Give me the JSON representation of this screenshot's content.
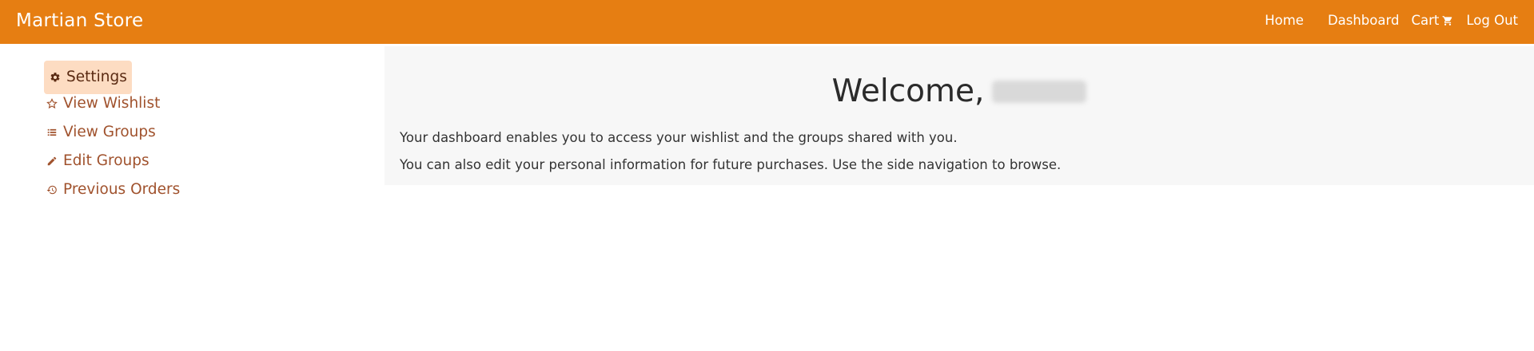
{
  "header": {
    "brand": "Martian Store",
    "nav": {
      "home": "Home",
      "dashboard": "Dashboard",
      "cart": "Cart",
      "logout": "Log Out"
    },
    "background": "#e67e12"
  },
  "sidebar": {
    "items": [
      {
        "label": "Settings",
        "icon": "gear-icon",
        "active": true
      },
      {
        "label": "View Wishlist",
        "icon": "star-icon",
        "active": false
      },
      {
        "label": "View Groups",
        "icon": "list-icon",
        "active": false
      },
      {
        "label": "Edit Groups",
        "icon": "pencil-icon",
        "active": false
      },
      {
        "label": "Previous Orders",
        "icon": "history-icon",
        "active": false
      }
    ],
    "active_background": "#fddcc2",
    "link_color": "#a0522d"
  },
  "main": {
    "welcome": "Welcome,",
    "paragraph_1": "Your dashboard enables you to access your wishlist and the groups shared with you.",
    "paragraph_2": "You can also edit your personal information for future purchases. Use the side navigation to browse.",
    "panel_background": "#f7f7f7"
  }
}
